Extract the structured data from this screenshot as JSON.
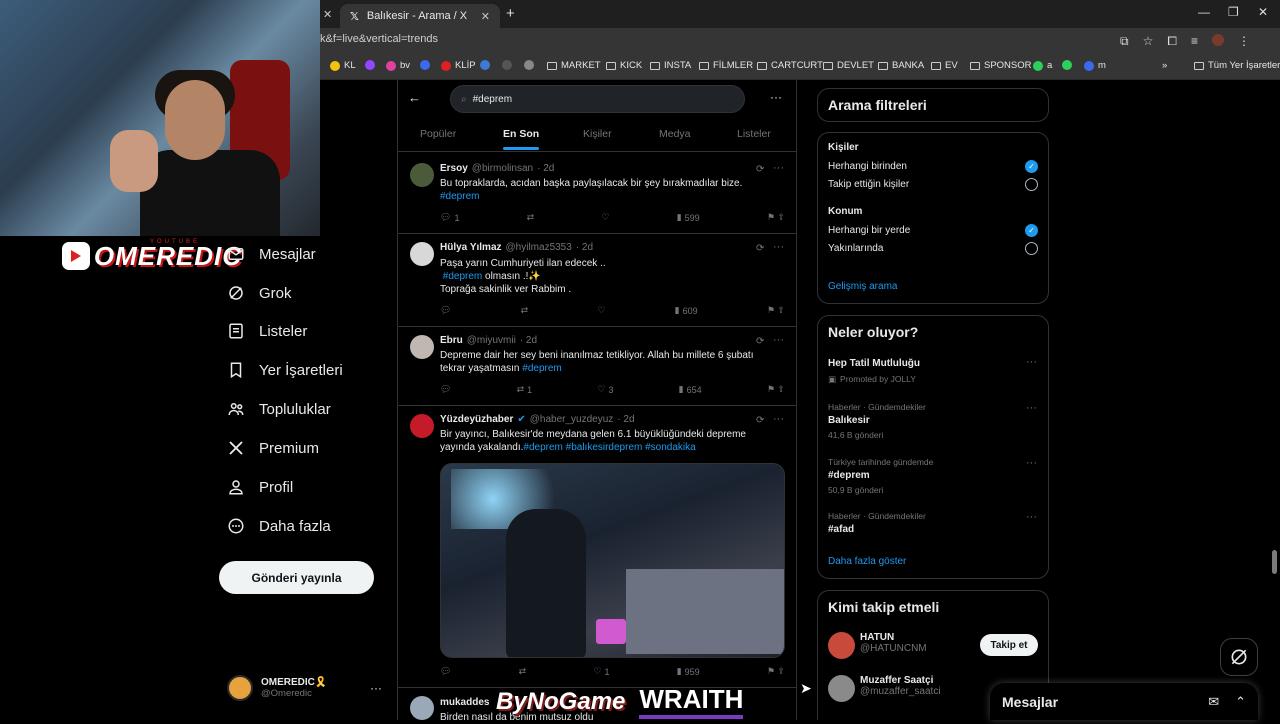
{
  "browser": {
    "tab_title": "Balıkesir - Arama / X",
    "url": "k&f=live&vertical=trends",
    "bookmarks": [
      "KL",
      "bv",
      "KLİP",
      "MARKET",
      "KICK",
      "INSTA",
      "FİLMLER",
      "CARTCURT",
      "DEVLET",
      "BANKA",
      "EV",
      "SPONSOR",
      "a",
      "m"
    ],
    "all_bookmarks": "Tüm Yer İşaretleri"
  },
  "stream": {
    "channel_label": "OMEREDIC",
    "youtube_tag": "YOUTUBE",
    "overlay_brand_1": "ByNoGame",
    "overlay_brand_2": "WRAITH"
  },
  "nav": {
    "items": [
      "Mesajlar",
      "Grok",
      "Listeler",
      "Yer İşaretleri",
      "Topluluklar",
      "Premium",
      "Profil",
      "Daha fazla"
    ],
    "post_button": "Gönderi yayınla",
    "account_name": "OMEREDIC🎗️",
    "account_handle": "@Omeredic"
  },
  "search": {
    "query": "#deprem",
    "tabs": [
      "Popüler",
      "En Son",
      "Kişiler",
      "Medya",
      "Listeler"
    ],
    "active_tab": "En Son"
  },
  "tweets": [
    {
      "name": "Ersoy",
      "handle": "@birmolinsan",
      "time": "· 2d",
      "line1": "Bu topraklarda, acıdan başka paylaşılacak bir şey bırakmadılar bize.",
      "tags": "#deprem",
      "replies": "1",
      "retweets": "",
      "likes": "",
      "views": "599"
    },
    {
      "name": "Hülya Yılmaz",
      "handle": "@hyilmaz5353",
      "time": "· 2d",
      "line1": "Paşa yarın Cumhuriyeti ilan edecek ..",
      "tag_inline": "#deprem",
      "line2_rest": " olmasın .!✨",
      "line3": "Toprağa sakinlik ver Rabbim .",
      "replies": "",
      "retweets": "",
      "likes": "",
      "views": "609"
    },
    {
      "name": "Ebru",
      "handle": "@miyuvmii",
      "time": "· 2d",
      "line1": "Depreme dair her sey beni inanılmaz tetikliyor. Allah bu millete 6 şubatı",
      "line2": "tekrar yaşatmasın ",
      "tags": "#deprem",
      "replies": "",
      "retweets": "1",
      "likes": "3",
      "views": "654"
    },
    {
      "name": "Yüzdeyüzhaber",
      "handle": "@haber_yuzdeyuz",
      "time": "· 2d",
      "line1": "Bir yayıncı, Balıkesir'de meydana gelen 6.1 büyüklüğündeki depreme",
      "line2": "yayında yakalandı.",
      "tags": "#deprem #balıkesirdeprem #sondakika",
      "replies": "",
      "retweets": "",
      "likes": "1",
      "views": "959"
    },
    {
      "name": "mukaddes",
      "handle": "",
      "time": "",
      "line1": "Birden nasıl da benim mutsuz oldu"
    }
  ],
  "filters": {
    "title": "Arama filtreleri",
    "people_heading": "Kişiler",
    "people_options": [
      "Herhangi birinden",
      "Takip ettiğin kişiler"
    ],
    "location_heading": "Konum",
    "location_options": [
      "Herhangi bir yerde",
      "Yakınlarında"
    ],
    "advanced": "Gelişmiş arama"
  },
  "trends": {
    "title": "Neler oluyor?",
    "items": [
      {
        "sub": "",
        "name": "Hep Tatil Mutluluğu",
        "meta": "Promoted by JOLLY"
      },
      {
        "sub": "Haberler · Gündemdekiler",
        "name": "Balıkesir",
        "meta": "41,6 B gönderi"
      },
      {
        "sub": "Türkiye tarihinde gündemde",
        "name": "#deprem",
        "meta": "50,9 B gönderi"
      },
      {
        "sub": "Haberler · Gündemdekiler",
        "name": "#afad",
        "meta": ""
      }
    ],
    "show_more": "Daha fazla göster"
  },
  "who_to_follow": {
    "title": "Kimi takip etmeli",
    "users": [
      {
        "name": "HATUN",
        "handle": "@HATUNCNM",
        "button": "Takip et"
      },
      {
        "name": "Muzaffer Saatçi",
        "handle": "@muzaffer_saatci",
        "button": ""
      }
    ]
  },
  "messages_dock": {
    "title": "Mesajlar"
  },
  "colors": {
    "accent": "#1d9bf0",
    "background": "#000000",
    "border": "#2f3336",
    "muted": "#71767b"
  }
}
